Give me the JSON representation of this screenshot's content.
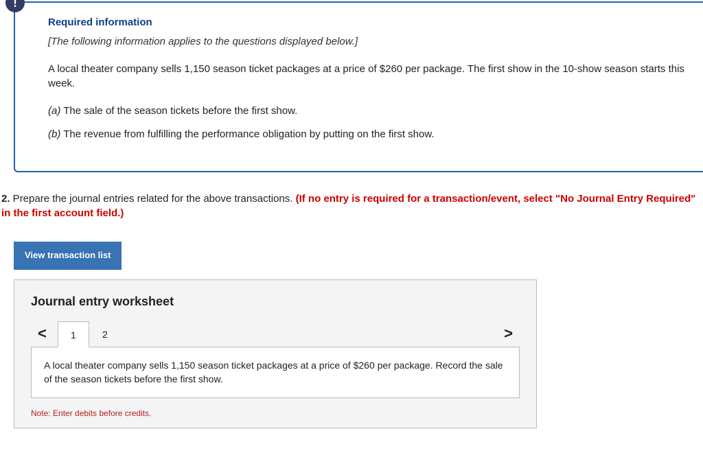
{
  "info": {
    "heading": "Required information",
    "instruction": "[The following information applies to the questions displayed below.]",
    "body": "A local theater company sells 1,150 season ticket packages at a price of $260 per package. The first show in the 10-show season starts this week.",
    "items": [
      {
        "label": "(a)",
        "text": " The sale of the season tickets before the first show."
      },
      {
        "label": "(b)",
        "text": " The revenue from fulfilling the performance obligation by putting on the first show."
      }
    ]
  },
  "question": {
    "number": "2.",
    "prompt_plain": " Prepare the journal entries related for the above transactions. ",
    "red_note": "(If no entry is required for a transaction/event, select \"No Journal Entry Required\" in the first account field.)"
  },
  "buttons": {
    "view_transaction": "View transaction list"
  },
  "worksheet": {
    "title": "Journal entry worksheet",
    "tabs": [
      "1",
      "2"
    ],
    "active_tab": 0,
    "description": "A local theater company sells 1,150 season ticket packages at a price of $260 per package. Record the sale of the season tickets before the first show.",
    "debit_note": "Note: Enter debits before credits."
  },
  "icons": {
    "info": "!",
    "prev": "<",
    "next": ">"
  }
}
